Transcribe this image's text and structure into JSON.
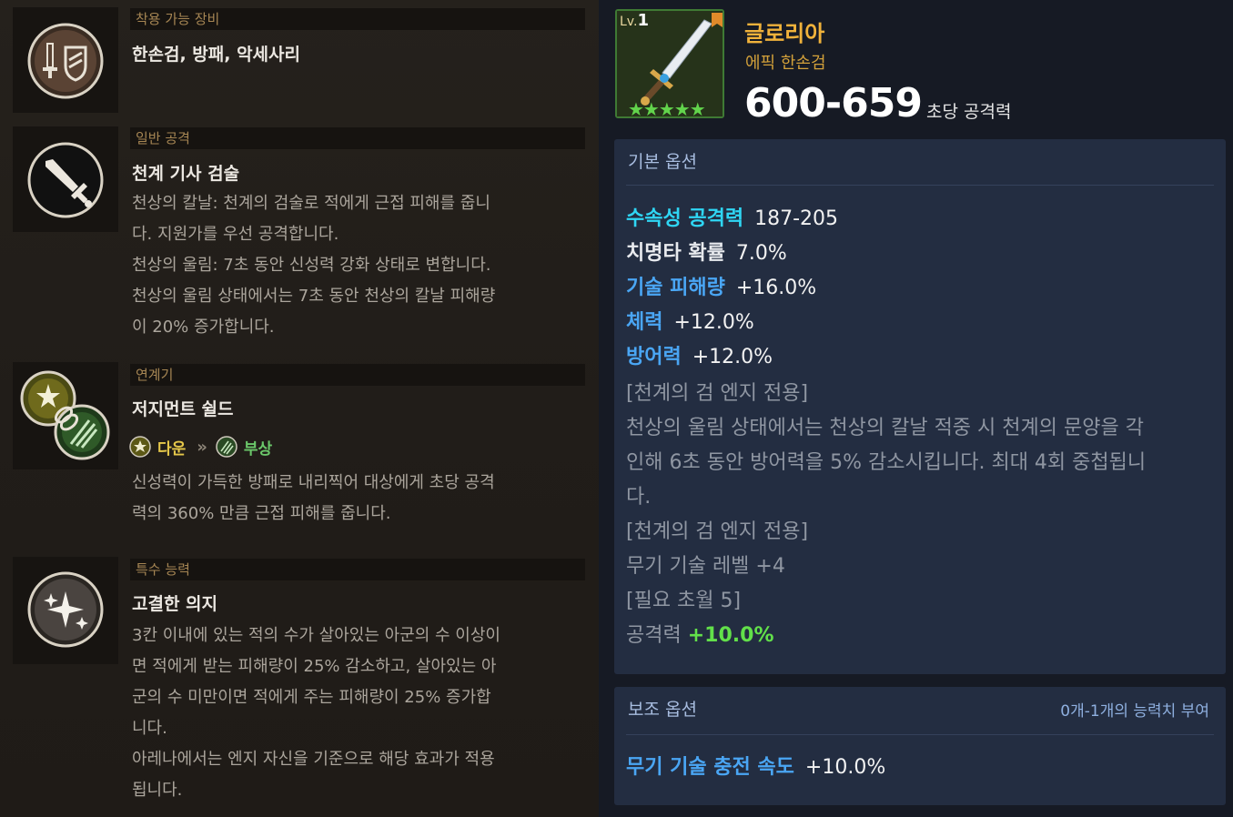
{
  "left": {
    "equip": {
      "header": "착용 가능 장비",
      "title": "한손검, 방패, 악세사리",
      "icon": "sword-shield-icon"
    },
    "normal": {
      "header": "일반 공격",
      "title": "천계 기사 검술",
      "icon": "sword-icon",
      "lines": [
        "천상의 칼날: 천계의 검술로 적에게 근접 피해를 줍니",
        "다. 지원가를 우선 공격합니다.",
        "천상의 울림: 7초 동안 신성력 강화 상태로 변합니다.",
        "천상의 울림 상태에서는 7초 동안 천상의 칼날 피해량",
        "이 20% 증가합니다."
      ]
    },
    "chain": {
      "header": "연계기",
      "title": "저지먼트 쉴드",
      "icon": "chain-skill-icon",
      "from_label": "다운",
      "to_label": "부상",
      "arrow": "»",
      "lines": [
        "신성력이 가득한 방패로 내리찍어 대상에게 초당 공격",
        "력의 360% 만큼 근접 피해를 줍니다."
      ]
    },
    "special": {
      "header": "특수 능력",
      "title": "고결한 의지",
      "icon": "sparkle-icon",
      "lines": [
        "3칸 이내에 있는 적의 수가 살아있는 아군의 수 이상이",
        "면 적에게 받는 피해량이 25% 감소하고, 살아있는 아",
        "군의 수 미만이면 적에게 주는 피해량이 25% 증가합",
        "니다.",
        "아레나에서는 엔지 자신을 기준으로 해당 효과가 적용",
        "됩니다."
      ]
    }
  },
  "item": {
    "level_prefix": "Lv.",
    "level": "1",
    "stars": "★★★★★",
    "star_count": 5,
    "name": "글로리아",
    "type": "에픽 한손검",
    "attack": "600-659",
    "attack_label": "초당 공격력",
    "icon": "greatsword-icon"
  },
  "basic": {
    "header": "기본 옵션",
    "stats": [
      {
        "k": "수속성 공격력",
        "v": "187-205"
      },
      {
        "k": "치명타 확률",
        "v": "7.0%"
      },
      {
        "k": "기술 피해량",
        "v": "+16.0%"
      },
      {
        "k": "체력",
        "v": "+12.0%"
      },
      {
        "k": "방어력",
        "v": "+12.0%"
      }
    ],
    "notes": [
      "[천계의 검 엔지 전용]",
      "천상의 울림 상태에서는 천상의 칼날 적중 시 천계의 문양을 각",
      "인해 6초 동안 방어력을 5% 감소시킵니다. 최대 4회 중첩됩니",
      "다.",
      "[천계의 검 엔지 전용]",
      "무기 기술 레벨 +4",
      "[필요 초월 5]"
    ],
    "final_label": "공격력",
    "final_value": "+10.0%"
  },
  "sub": {
    "header": "보조 옵션",
    "note": "0개-1개의 능력치 부여",
    "stat_label": "무기 기술 충전 속도",
    "stat_value": "+10.0%"
  },
  "colors": {
    "cyan": "#2fd6f4",
    "blue": "#4aa6f4",
    "gold": "#f0b23b",
    "green": "#62e04a"
  }
}
